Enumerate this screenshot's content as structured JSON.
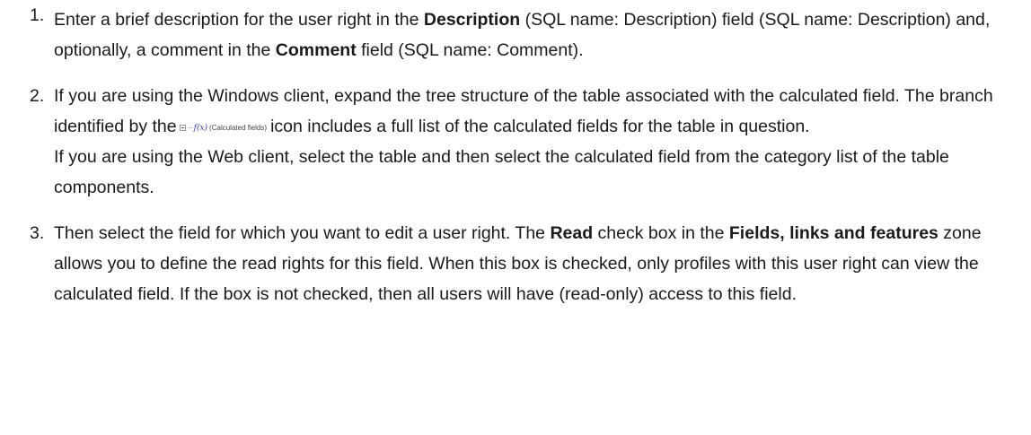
{
  "steps": [
    {
      "number": "1.",
      "parts": {
        "p1": "Enter a brief description for the user right in the ",
        "b1": "Description",
        "p2": " (SQL name: Description) field (SQL name: Description) and, optionally, a comment in the ",
        "b2": "Comment",
        "p3": " field (SQL name: Comment)."
      }
    },
    {
      "number": "2.",
      "parts": {
        "p1": "If you are using the Windows client, expand the tree structure of the table associated with the calculated field. The branch identified by the",
        "icon_caption": "(Calculated fields)",
        "p2": "icon includes a full list of the calculated fields for the table in question.",
        "p3": "If you are using the Web client, select the table and then select the calculated field from the category list of the table components."
      }
    },
    {
      "number": "3.",
      "parts": {
        "p1": "Then select the field for which you want to edit a user right. The ",
        "b1": "Read",
        "p2": " check box in the ",
        "b2": "Fields, links and features",
        "p3": " zone allows you to define the read rights for this field. When this box is checked, only profiles with this user right can view the calculated field. If the box is not checked, then all users will have (read-only) access to this field."
      }
    }
  ],
  "icons": {
    "calculated_fields_icon": "calculated-fields-tree-icon",
    "fx_glyph": "f(x)"
  }
}
